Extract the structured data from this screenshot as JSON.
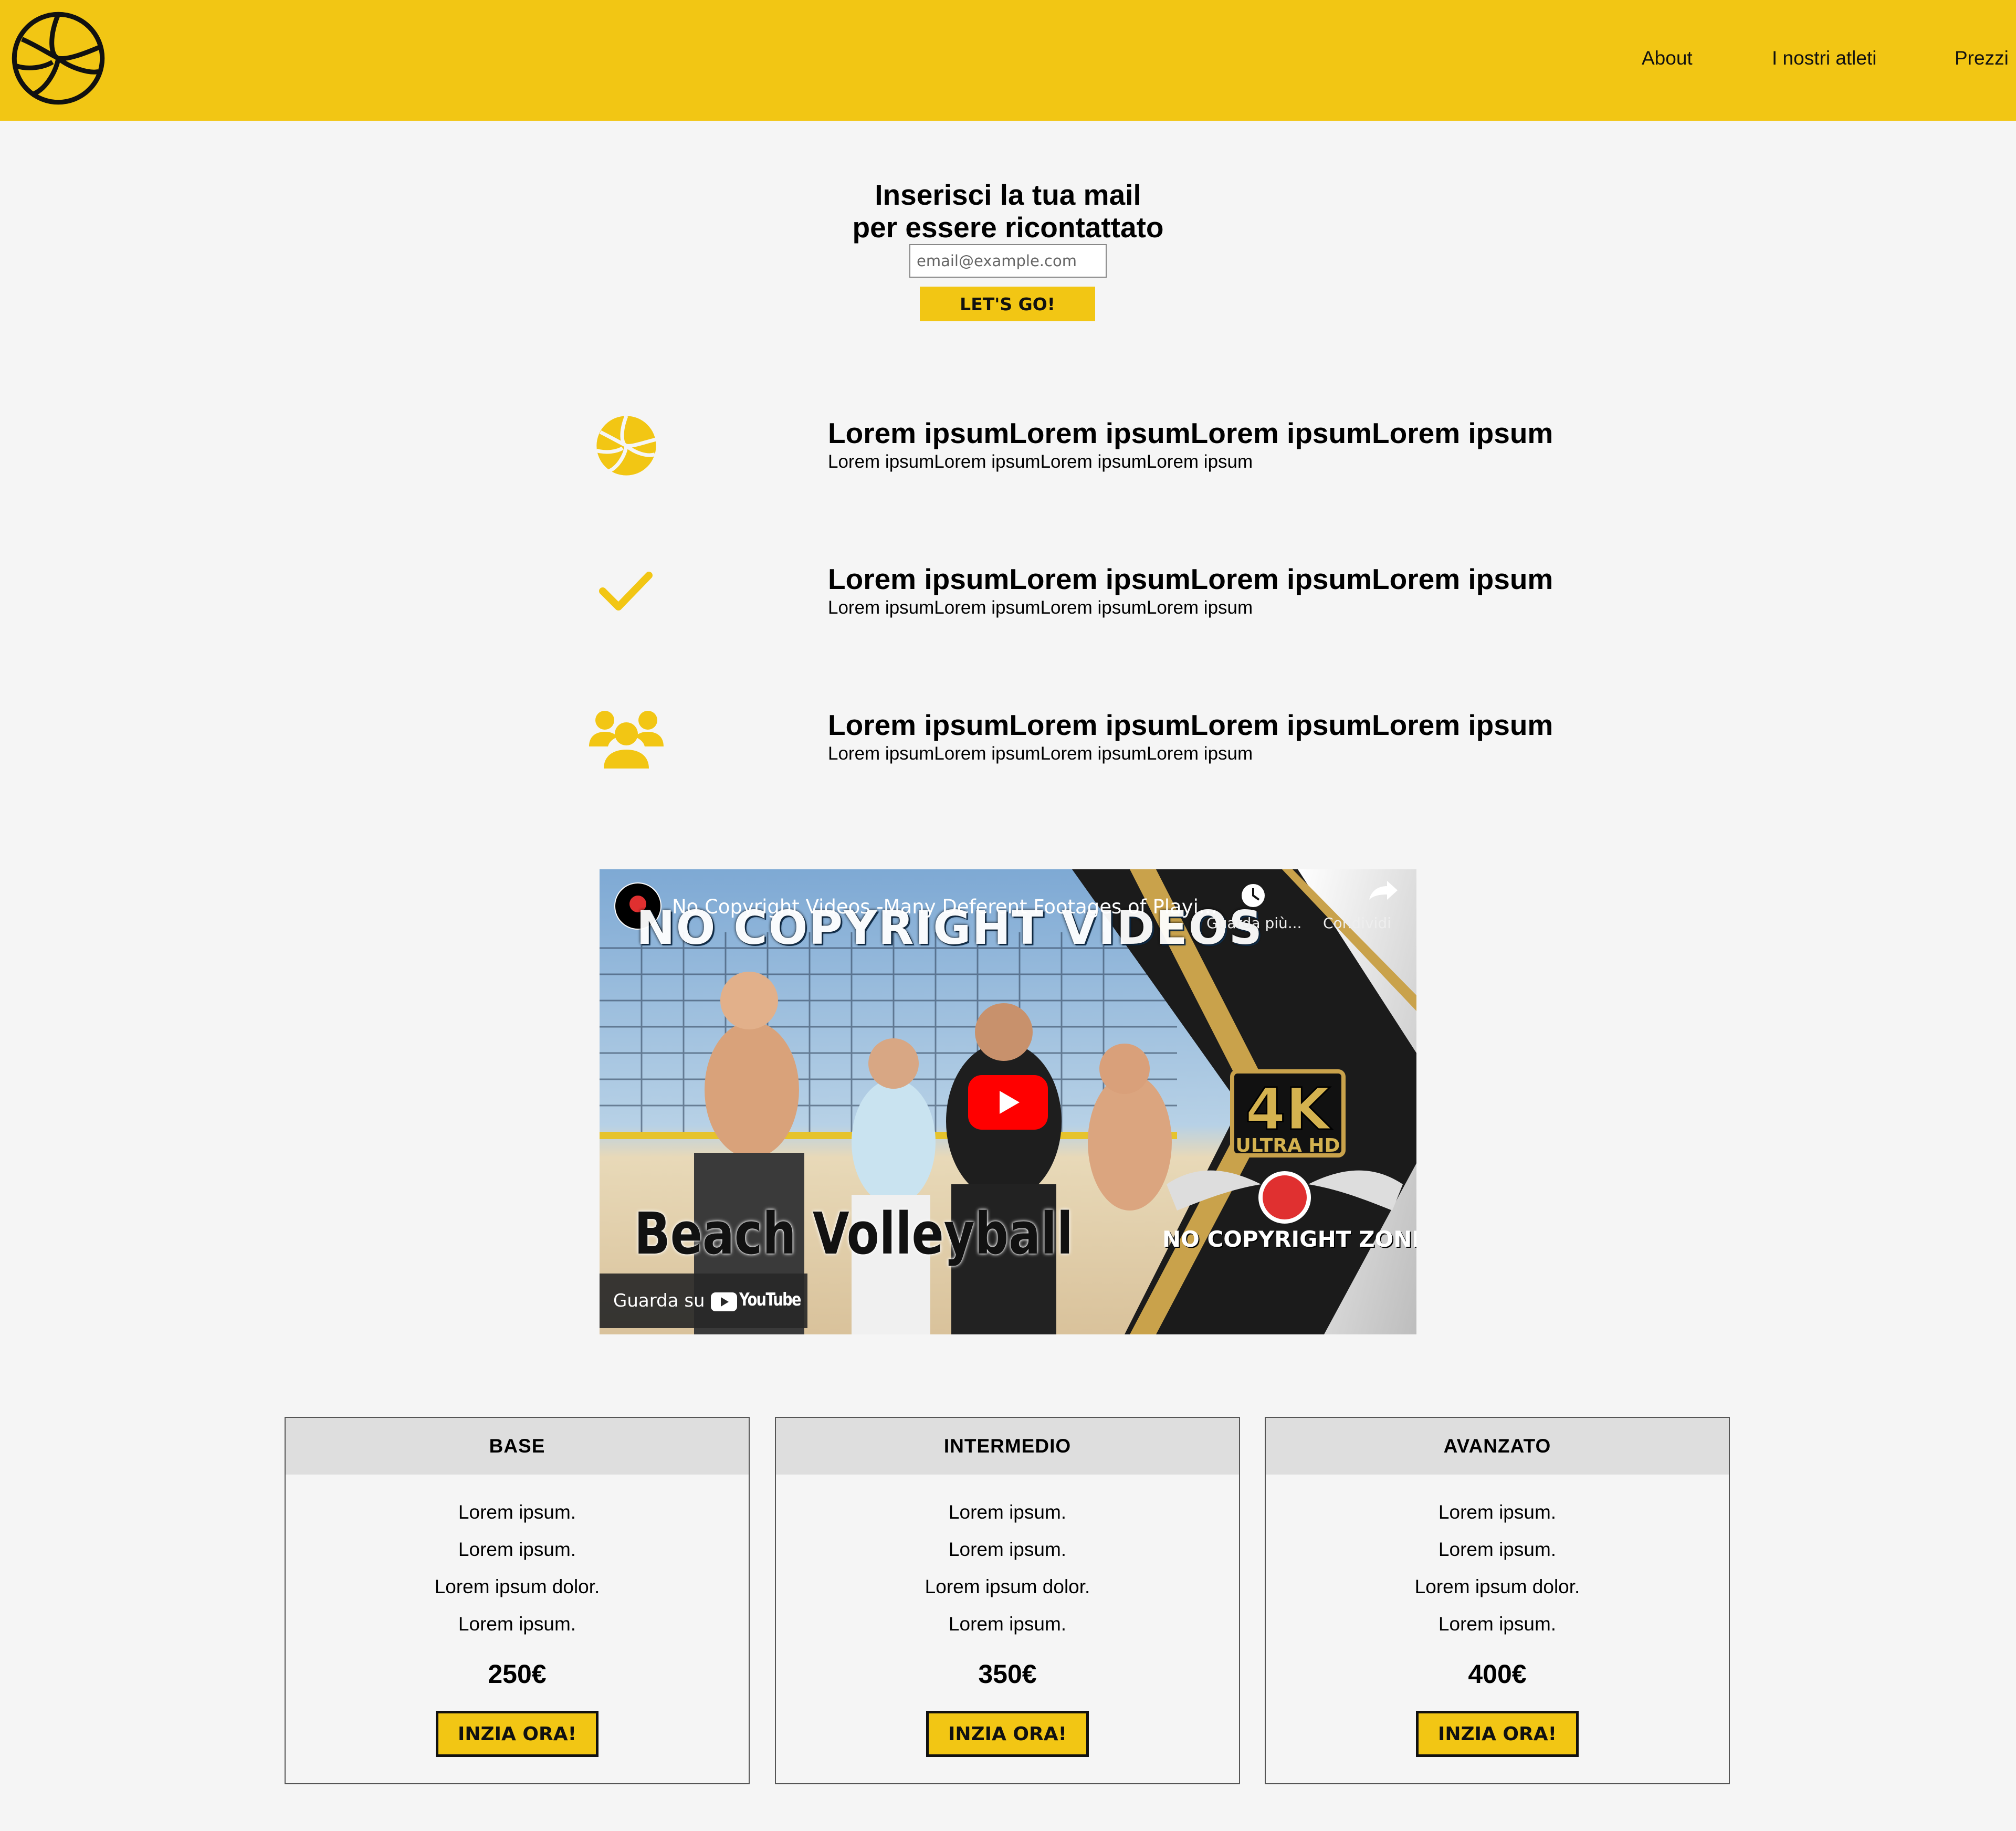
{
  "header": {
    "nav": [
      {
        "label": "About"
      },
      {
        "label": "I nostri atleti"
      },
      {
        "label": "Prezzi"
      }
    ]
  },
  "signup": {
    "title_line1": "Inserisci la tua mail",
    "title_line2": "per essere ricontattato",
    "email_placeholder": "email@example.com",
    "button_label": "LET'S GO!"
  },
  "features": [
    {
      "icon": "volleyball-icon",
      "title": "Lorem ipsumLorem ipsumLorem ipsumLorem ipsum",
      "text": "Lorem ipsumLorem ipsumLorem ipsumLorem ipsum"
    },
    {
      "icon": "check-icon",
      "title": "Lorem ipsumLorem ipsumLorem ipsumLorem ipsum",
      "text": "Lorem ipsumLorem ipsumLorem ipsumLorem ipsum"
    },
    {
      "icon": "users-icon",
      "title": "Lorem ipsumLorem ipsumLorem ipsumLorem ipsum",
      "text": "Lorem ipsumLorem ipsumLorem ipsumLorem ipsum"
    }
  ],
  "video": {
    "title": "No Copyright Videos -Many Deferent Footages of Playi...",
    "overlay_title": "NO COPYRIGHT VIDEOS",
    "watch_later": "Guarda più...",
    "share": "Condividi",
    "thumbnail_caption": "Beach Volleyball",
    "watch_on": "Guarda su",
    "youtube": "YouTube",
    "badge_4k": "4K",
    "badge_ultra": "ULTRA HD",
    "brand": "NO COPYRIGHT ZONE"
  },
  "pricing": [
    {
      "name": "BASE",
      "items": [
        "Lorem ipsum.",
        "Lorem ipsum.",
        "Lorem ipsum dolor.",
        "Lorem ipsum."
      ],
      "price": "250€",
      "button": "INZIA ORA!"
    },
    {
      "name": "INTERMEDIO",
      "items": [
        "Lorem ipsum.",
        "Lorem ipsum.",
        "Lorem ipsum dolor.",
        "Lorem ipsum."
      ],
      "price": "350€",
      "button": "INZIA ORA!"
    },
    {
      "name": "AVANZATO",
      "items": [
        "Lorem ipsum.",
        "Lorem ipsum.",
        "Lorem ipsum dolor.",
        "Lorem ipsum."
      ],
      "price": "400€",
      "button": "INZIA ORA!"
    }
  ],
  "colors": {
    "brand_yellow": "#f2c614",
    "background": "#f5f5f5",
    "card_header": "#dedede"
  }
}
